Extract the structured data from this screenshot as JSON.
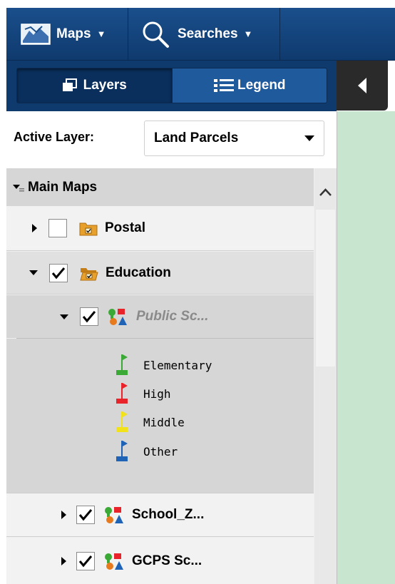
{
  "toolbar": {
    "maps_label": "Maps",
    "searches_label": "Searches"
  },
  "panel_tabs": {
    "layers_label": "Layers",
    "legend_label": "Legend"
  },
  "active_layer": {
    "label": "Active Layer:",
    "value": "Land Parcels"
  },
  "tree": {
    "group_label": "Main Maps",
    "items": [
      {
        "label": "Postal",
        "checked": false,
        "expanded": false
      },
      {
        "label": "Education",
        "checked": true,
        "expanded": true
      },
      {
        "label": "Public Sc...",
        "checked": true,
        "expanded": true
      },
      {
        "label": "School_Z...",
        "checked": true,
        "expanded": false
      },
      {
        "label": "GCPS Sc...",
        "checked": true,
        "expanded": false
      }
    ],
    "legend": [
      {
        "label": "Elementary",
        "color": "#3aa935"
      },
      {
        "label": "High",
        "color": "#e8232a"
      },
      {
        "label": "Middle",
        "color": "#f2e21a"
      },
      {
        "label": "Other",
        "color": "#1e63b5"
      }
    ]
  },
  "colors": {
    "toolbar": "#1a4f8c",
    "map_background": "#c7e5cf",
    "tree_background": "#efefef"
  }
}
